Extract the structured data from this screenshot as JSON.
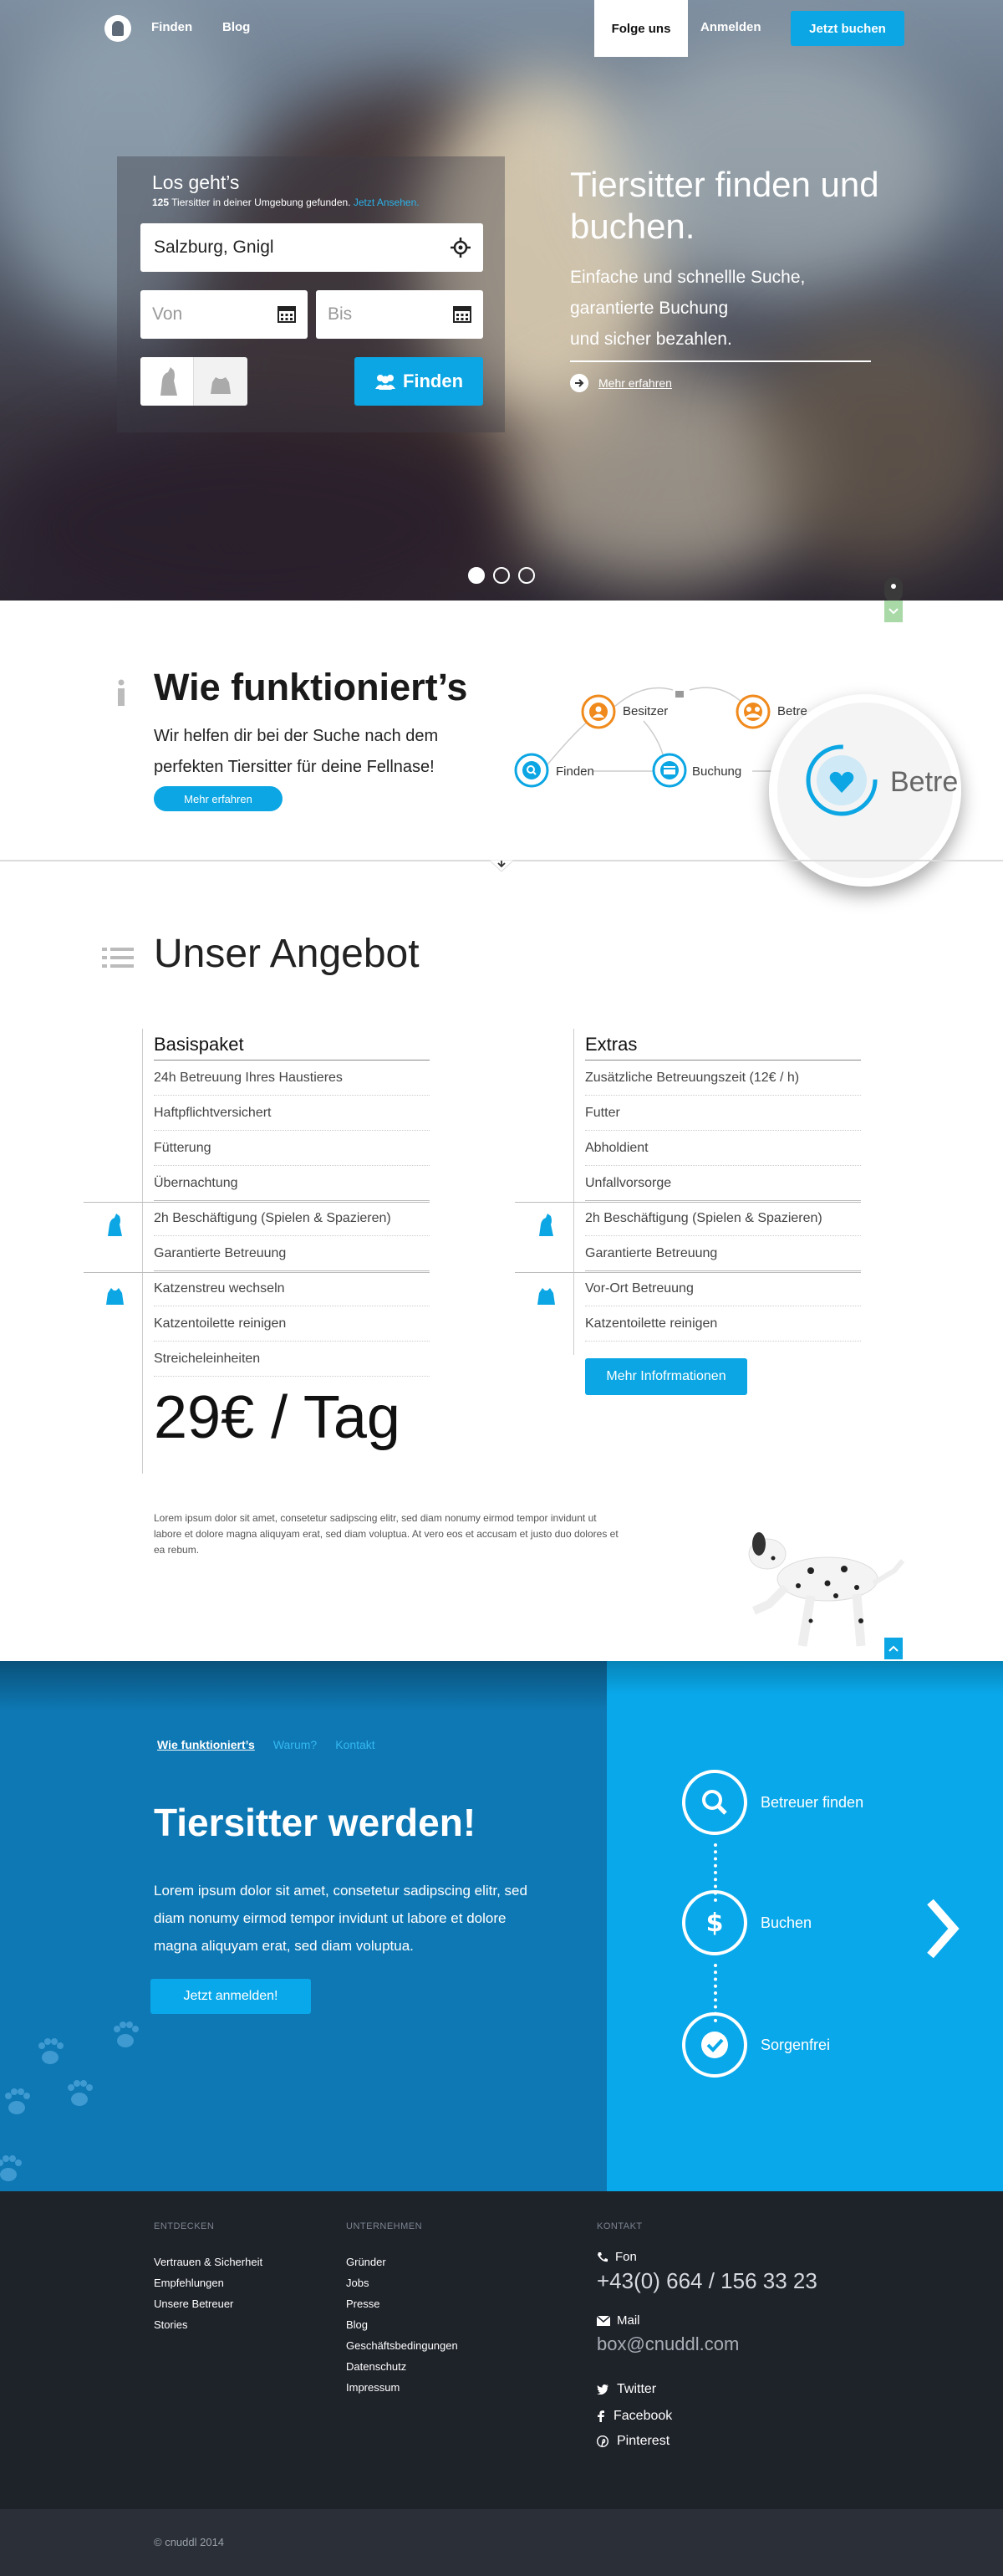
{
  "nav": {
    "find": "Finden",
    "blog": "Blog",
    "follow": "Folge uns",
    "login": "Anmelden",
    "book": "Jetzt buchen"
  },
  "search": {
    "title": "Los geht’s",
    "count": "125",
    "subtitle": "Tiersitter in deiner Umgebung gefunden.",
    "link": "Jetzt Ansehen.",
    "location_value": "Salzburg, Gnigl",
    "from_placeholder": "Von",
    "to_placeholder": "Bis",
    "find_button": "Finden"
  },
  "hero": {
    "title": "Tiersitter finden und buchen.",
    "subtitle_lines": [
      "Einfache und schnellle Suche,",
      "garantierte Buchung",
      "und sicher bezahlen."
    ],
    "more": "Mehr erfahren",
    "slides": 3,
    "active_slide": 1
  },
  "how": {
    "title": "Wie funktioniert’s",
    "text": "Wir helfen dir bei der Suche nach dem perfekten Tiersitter für deine Fellnase!",
    "button": "Mehr erfahren",
    "flow": {
      "besitzer": "Besitzer",
      "betreuer_partial": "Betre",
      "finden": "Finden",
      "buchung": "Buchung",
      "magnified": "Betre"
    }
  },
  "offer": {
    "title": "Unser Angebot",
    "basis": {
      "title": "Basispaket",
      "items": [
        "24h Betreuung Ihres Haustieres",
        "Haftpflichtversichert",
        "Fütterung",
        "Übernachtung",
        "2h Beschäftigung (Spielen & Spazieren)",
        "Garantierte Betreuung",
        "Katzenstreu wechseln",
        "Katzentoilette reinigen",
        "Streicheleinheiten"
      ]
    },
    "extras": {
      "title": "Extras",
      "items": [
        "Zusätzliche Betreuungszeit (12€ / h)",
        "Futter",
        "Abholdient",
        "Unfallvorsorge",
        "2h Beschäftigung (Spielen & Spazieren)",
        "Garantierte Betreuung",
        "Vor-Ort Betreuung",
        "Katzentoilette reinigen"
      ],
      "button": "Mehr Infofrmationen"
    },
    "price": "29€ / Tag",
    "lorem": "Lorem ipsum dolor sit amet, consetetur sadipscing elitr, sed diam nonumy eirmod tempor invidunt ut labore et dolore magna aliquyam erat, sed diam voluptua. At vero eos et accusam et justo duo dolores et ea rebum."
  },
  "become": {
    "tabs": [
      "Wie funktioniert’s",
      "Warum?",
      "Kontakt"
    ],
    "title": "Tiersitter werden!",
    "text": "Lorem ipsum dolor sit amet, consetetur sadipscing elitr, sed diam nonumy eirmod tempor invidunt ut labore et dolore magna aliquyam erat, sed diam voluptua.",
    "button": "Jetzt anmelden!",
    "steps": [
      "Betreuer finden",
      "Buchen",
      "Sorgenfrei"
    ]
  },
  "footer": {
    "discover": {
      "title": "ENTDECKEN",
      "items": [
        "Vertrauen & Sicherheit",
        "Empfehlungen",
        "Unsere Betreuer",
        "Stories"
      ]
    },
    "company": {
      "title": "UNTERNEHMEN",
      "items": [
        "Gründer",
        "Jobs",
        "Presse",
        "Blog",
        "Geschäftsbedingungen",
        "Datenschutz",
        "Impressum"
      ]
    },
    "contact": {
      "title": "KONTAKT",
      "phone_label": "Fon",
      "phone": "+43(0) 664 / 156 33 23",
      "mail_label": "Mail",
      "mail": "box@cnuddl.com",
      "social": [
        "Twitter",
        "Facebook",
        "Pinterest"
      ]
    },
    "copyright": "© cnuddl 2014"
  },
  "colors": {
    "accent": "#0ba6e3",
    "blue_dark": "#0e78b4",
    "blue_light": "#09a8ea",
    "footer": "#1e2229",
    "orange": "#f08a1c"
  }
}
